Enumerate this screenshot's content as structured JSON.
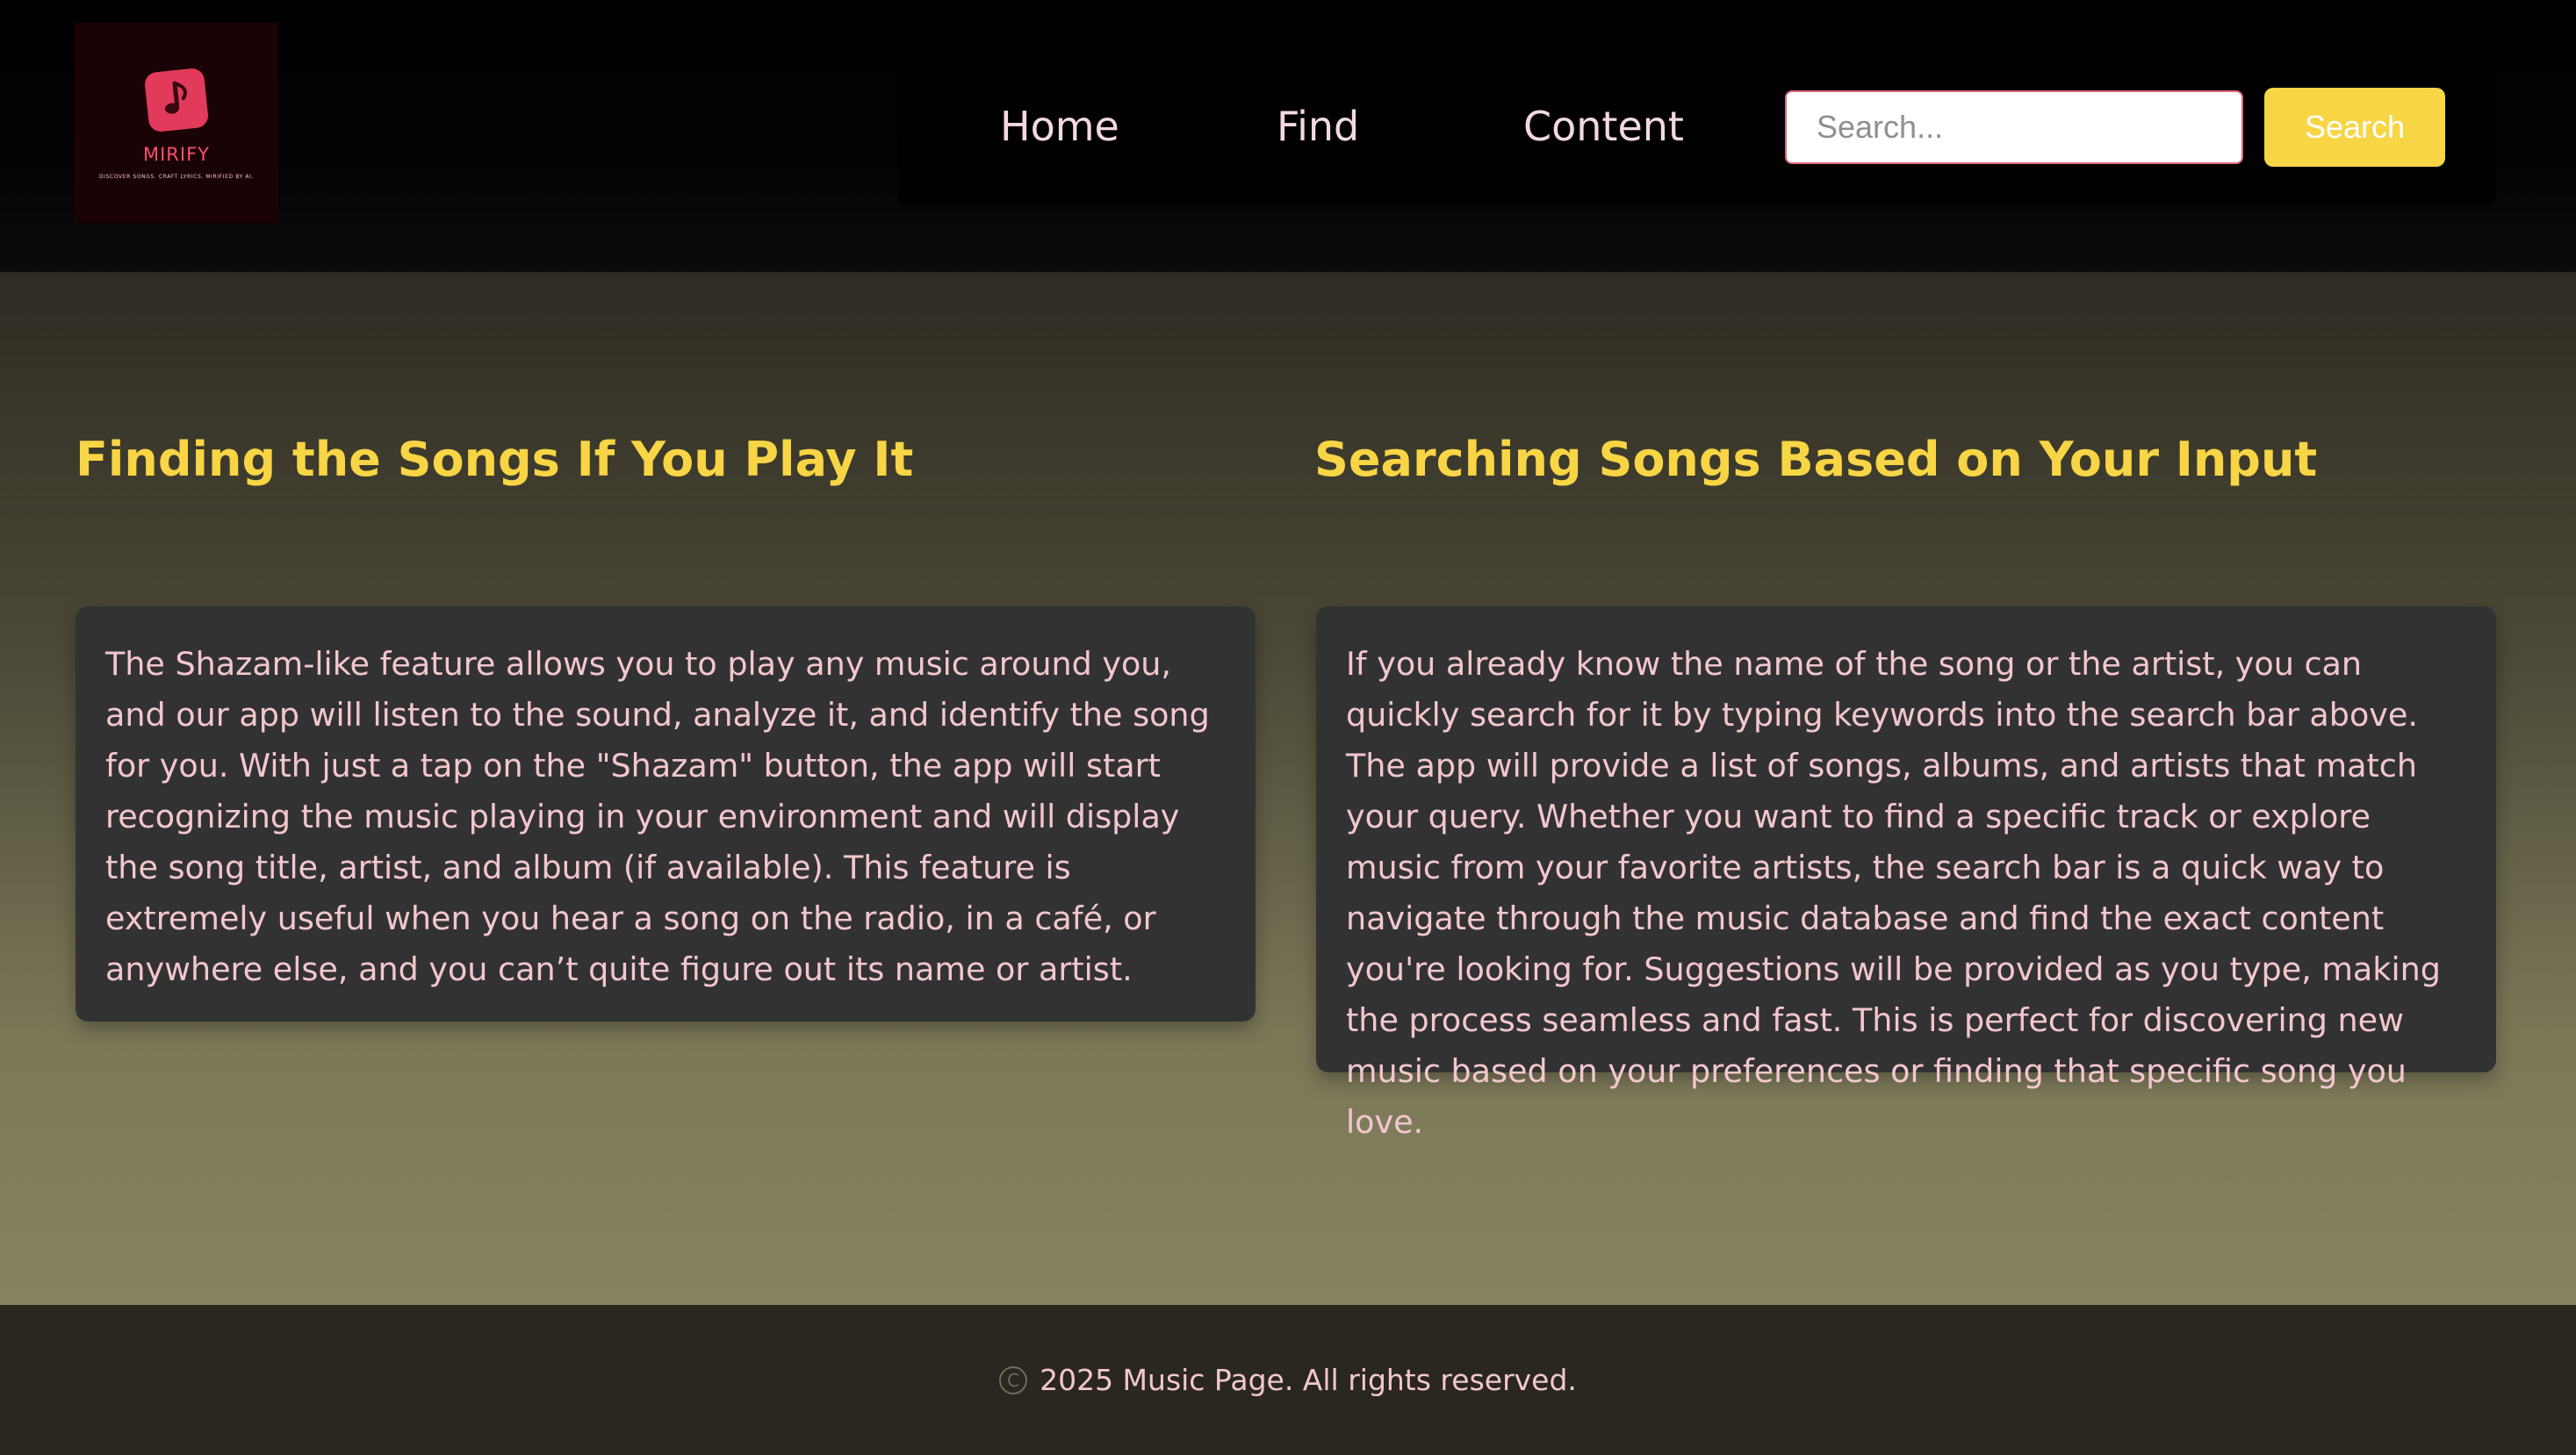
{
  "brand": {
    "name": "MIRIFY",
    "tagline": "DISCOVER SONGS. CRAFT LYRICS. MIRIFIED BY AI.",
    "icon": "music-note-icon",
    "colors": {
      "badge": "#e23a5a",
      "background": "#1a0306"
    }
  },
  "nav": {
    "items": [
      {
        "label": "Home"
      },
      {
        "label": "Find"
      },
      {
        "label": "Content"
      }
    ]
  },
  "search": {
    "placeholder": "Search...",
    "value": "",
    "button_label": "Search"
  },
  "sections": [
    {
      "title": "Finding the Songs If You Play It",
      "body": "The Shazam-like feature allows you to play any music around you, and our app will listen to the sound, analyze it, and identify the song for you. With just a tap on the \"Shazam\" button, the app will start recognizing the music playing in your environment and will display the song title, artist, and album (if available). This feature is extremely useful when you hear a song on the radio, in a café, or anywhere else, and you can’t quite figure out its name or artist."
    },
    {
      "title": "Searching Songs Based on Your Input",
      "body": "If you already know the name of the song or the artist, you can quickly search for it by typing keywords into the search bar above. The app will provide a list of songs, albums, and artists that match your query. Whether you want to find a specific track or explore music from your favorite artists, the search bar is a quick way to navigate through the music database and find the exact content you're looking for. Suggestions will be provided as you type, making the process seamless and fast. This is perfect for discovering new music based on your preferences or finding that specific song you love."
    }
  ],
  "footer": {
    "icon": "copyright-icon",
    "text": "2025 Music Page. All rights reserved."
  },
  "theme": {
    "accent": "#f7d545",
    "text": "#f2c7cd",
    "card": "#333233",
    "header": "#000000",
    "footer": "#29271f"
  }
}
